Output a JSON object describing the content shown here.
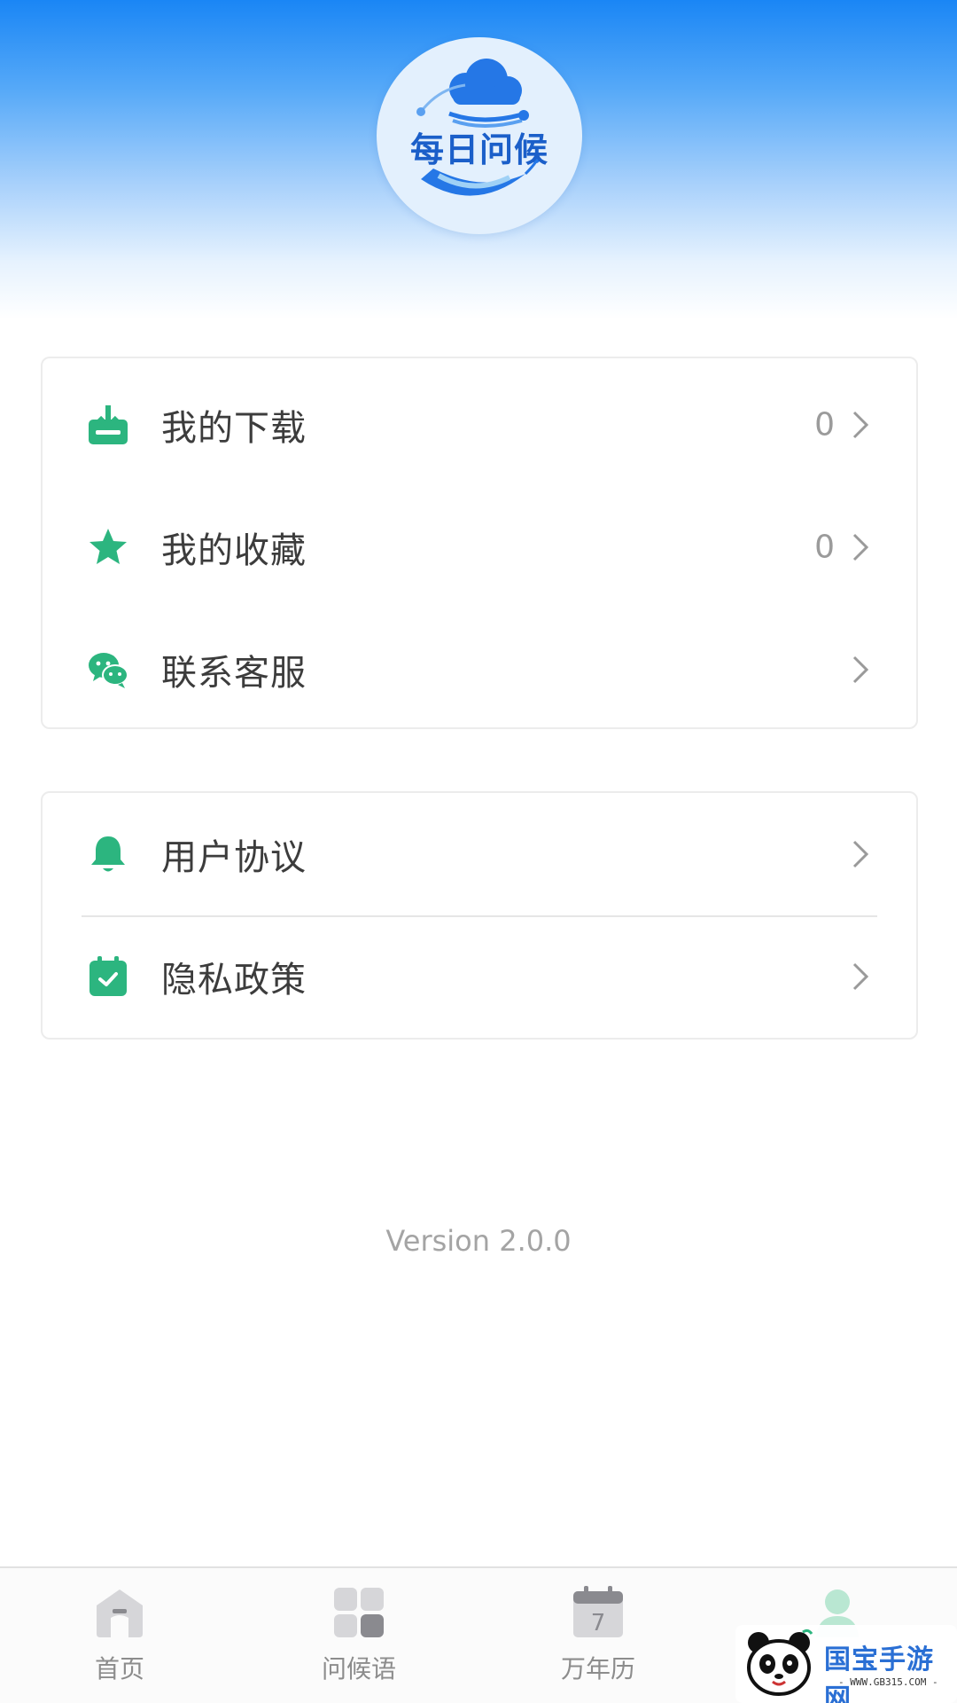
{
  "header": {
    "logo_text": "每日问候",
    "brand_color": "#1a86f5"
  },
  "menu_group_1": [
    {
      "label": "我的下载",
      "count": "0",
      "icon": "download-icon"
    },
    {
      "label": "我的收藏",
      "count": "0",
      "icon": "star-icon"
    },
    {
      "label": "联系客服",
      "count": "",
      "icon": "wechat-icon"
    }
  ],
  "menu_group_2": [
    {
      "label": "用户协议",
      "icon": "bell-icon"
    },
    {
      "label": "隐私政策",
      "icon": "calendar-check-icon"
    }
  ],
  "version": "Version 2.0.0",
  "accent_color": "#2cb57f",
  "tabbar": [
    {
      "label": "首页",
      "icon": "home-icon"
    },
    {
      "label": "问候语",
      "icon": "grid-icon"
    },
    {
      "label": "万年历",
      "icon": "calendar-icon",
      "day": "7"
    },
    {
      "label": "",
      "icon": "user-icon"
    }
  ],
  "watermark": {
    "text": "国宝手游网",
    "sub": "- WWW.GB315.COM -"
  }
}
